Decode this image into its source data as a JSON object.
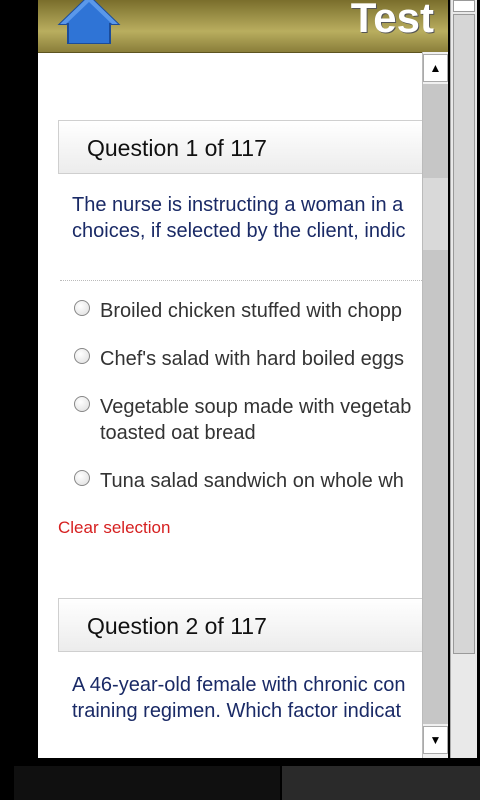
{
  "header": {
    "title": "Test"
  },
  "questions": [
    {
      "heading": "Question 1 of 117",
      "text_lines": [
        "The nurse is instructing a woman in a",
        "choices, if selected by the client, indic"
      ],
      "options": [
        "Broiled chicken stuffed with chopp",
        "Chef's salad with hard boiled eggs",
        "Vegetable soup made with vegetab\ntoasted oat bread",
        "Tuna salad sandwich on whole wh"
      ],
      "clear_label": "Clear selection"
    },
    {
      "heading": "Question 2 of 117",
      "text_lines": [
        "A 46-year-old female with chronic con",
        "training regimen. Which factor indicat"
      ]
    }
  ],
  "icons": {
    "home": "home-icon",
    "up": "scroll-up-arrow",
    "down": "scroll-down-arrow"
  },
  "colors": {
    "header": "#b9ae5f",
    "home_icon": "#2f74d6",
    "question_text": "#1a2a66",
    "clear_link": "#d62020"
  }
}
